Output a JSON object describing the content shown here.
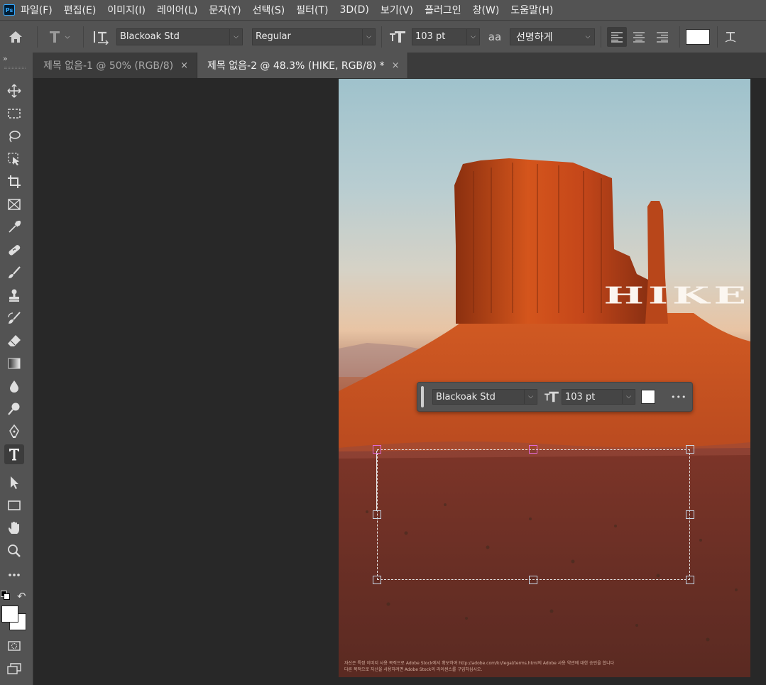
{
  "app": {
    "logo_text": "Ps"
  },
  "menu": [
    "파일(F)",
    "편집(E)",
    "이미지(I)",
    "레이어(L)",
    "문자(Y)",
    "선택(S)",
    "필터(T)",
    "3D(D)",
    "보기(V)",
    "플러그인",
    "창(W)",
    "도움말(H)"
  ],
  "options": {
    "font_family": "Blackoak Std",
    "font_style": "Regular",
    "font_size": "103 pt",
    "antialias_label": "aa",
    "antialias_mode": "선명하게",
    "text_color": "#ffffff"
  },
  "tabs": [
    {
      "label": "제목 없음-1 @ 50% (RGB/8)",
      "active": false,
      "close": "×"
    },
    {
      "label": "제목 없음-2 @ 48.3% (HIKE, RGB/8) *",
      "active": true,
      "close": "×"
    }
  ],
  "canvas": {
    "headline": "HIKE",
    "footnote_line1": "자산은 특정 이미지 사용 목적으로 Adobe Stock에서 확보하여 http://adobe.com/kr/legal/terms.html의 Adobe 사용 약관에 대한 승인을 합니다",
    "footnote_line2": "다른 목적으로 자산을 사용하려면 Adobe Stock의 라이센스를 구입하십시오."
  },
  "floating_bar": {
    "font_family": "Blackoak Std",
    "font_size": "103 pt",
    "color": "#ffffff",
    "more_label": "•••"
  },
  "colors": {
    "foreground": "#ffffff",
    "background": "#ffffff",
    "accent": "#31a8ff"
  }
}
